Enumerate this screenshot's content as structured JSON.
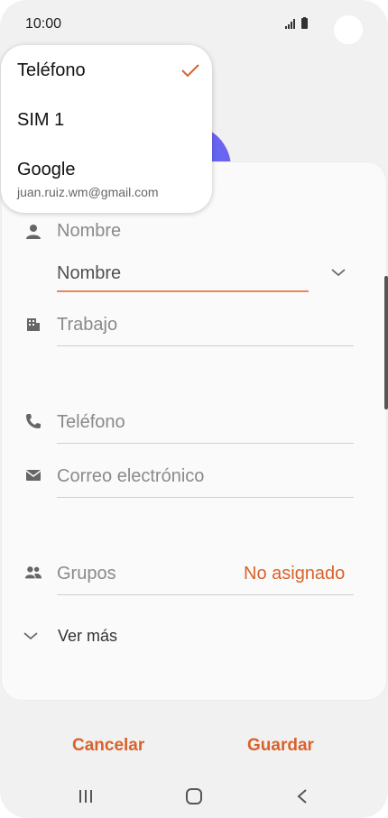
{
  "status_bar": {
    "time": "10:00",
    "signal_icon": "signal-icon",
    "battery_icon": "battery-icon"
  },
  "dropdown": {
    "items": [
      {
        "label": "Teléfono",
        "selected": true
      },
      {
        "label": "SIM 1"
      },
      {
        "label": "Google",
        "sublabel": "juan.ruiz.wm@gmail.com"
      }
    ],
    "check_icon": "check-icon"
  },
  "form": {
    "name_label": "Nombre",
    "name_field_placeholder": "Nombre",
    "work_label": "Trabajo",
    "phone_label": "Teléfono",
    "email_label": "Correo electrónico",
    "groups_label": "Grupos",
    "groups_value": "No asignado",
    "more_label": "Ver más"
  },
  "actions": {
    "cancel": "Cancelar",
    "save": "Guardar"
  },
  "nav": {
    "recents": "recents-icon",
    "home": "home-icon",
    "back": "back-icon"
  },
  "colors": {
    "accent": "#d9622b",
    "underline_active": "#e5895c",
    "background": "#f1f1f1"
  }
}
